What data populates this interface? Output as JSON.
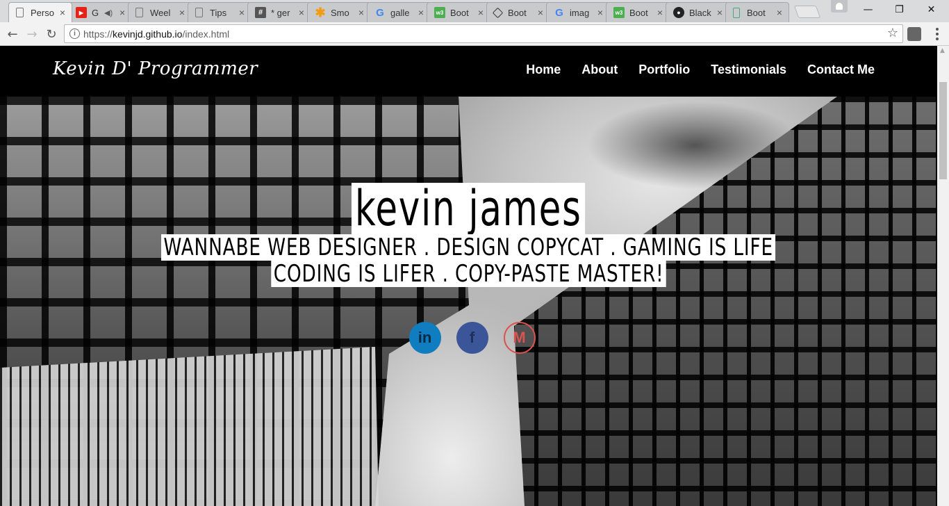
{
  "browser": {
    "tabs": [
      {
        "title": "Perso",
        "favicon": "page-icon",
        "active": true
      },
      {
        "title": "G",
        "favicon": "youtube-icon",
        "audio": true
      },
      {
        "title": "Weel",
        "favicon": "page-icon"
      },
      {
        "title": "Tips",
        "favicon": "page-icon"
      },
      {
        "title": "* ger",
        "favicon": "hash-icon"
      },
      {
        "title": "Smo",
        "favicon": "asterisk-icon"
      },
      {
        "title": "galle",
        "favicon": "google-icon"
      },
      {
        "title": "Boot",
        "favicon": "w3schools-icon"
      },
      {
        "title": "Boot",
        "favicon": "codepen-icon"
      },
      {
        "title": "imag",
        "favicon": "google-icon"
      },
      {
        "title": "Boot",
        "favicon": "w3schools-icon"
      },
      {
        "title": "Black",
        "favicon": "github-icon"
      },
      {
        "title": "Boot",
        "favicon": "mobile-icon"
      }
    ],
    "tab_close_glyph": "×",
    "window_controls": {
      "minimize": "—",
      "maximize": "❐",
      "close": "✕"
    },
    "url_prefix": "https://",
    "url_host": "kevinjd.github.io",
    "url_path": "/index.html"
  },
  "site": {
    "brand": "Kevin D' Programmer",
    "nav": [
      "Home",
      "About",
      "Portfolio",
      "Testimonials",
      "Contact Me"
    ],
    "hero": {
      "name": "kevin james",
      "subtitle_line1": "wannabe web designer . design copycat . gaming is life",
      "subtitle_line2": "coding is lifer . copy-paste master!"
    },
    "social": [
      {
        "name": "linkedin",
        "glyph": "in",
        "color": "#0f7dbf"
      },
      {
        "name": "facebook",
        "glyph": "f",
        "color": "#3a5598"
      },
      {
        "name": "gmail",
        "glyph": "M",
        "color": "#d9534f"
      }
    ]
  }
}
